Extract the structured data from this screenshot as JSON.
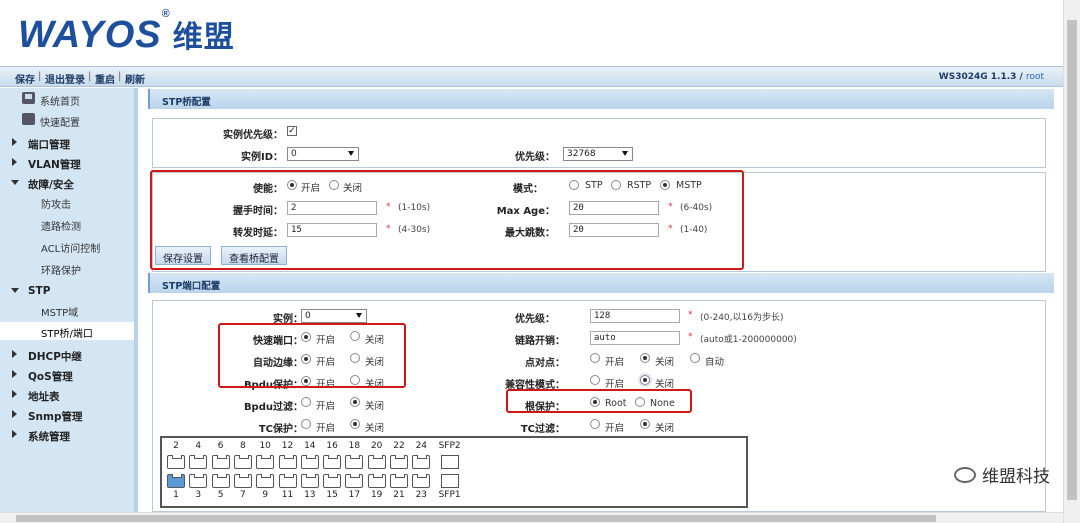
{
  "brand": {
    "name": "WAYOS",
    "reg": "®",
    "cn": "维盟"
  },
  "toolbar": {
    "save": "保存",
    "logout": "退出登录",
    "reboot": "重启",
    "refresh": "刷新",
    "sep": "|",
    "version": "WS3024G 1.1.3 /",
    "user": "root"
  },
  "sidebar": {
    "home": "系统首页",
    "quick": "快速配置",
    "port_mgmt": "端口管理",
    "vlan": "VLAN管理",
    "fault": "故障/安全",
    "anti_attack": "防攻击",
    "loop_detect": "遗路检测",
    "acl": "ACL访问控制",
    "ring": "环路保护",
    "stp": "STP",
    "mstp": "MSTP域",
    "stp_bridge": "STP桥/端口",
    "dhcp": "DHCP中继",
    "qos": "QoS管理",
    "addr": "地址表",
    "snmp": "Snmp管理",
    "sys": "系统管理"
  },
  "bridge": {
    "title": "STP桥配置",
    "instance_priority_label": "实例优先级：",
    "instance_priority_checked": true,
    "instance_id_label": "实例ID：",
    "instance_id_value": "0",
    "priority_label": "优先级：",
    "priority_value": "32768",
    "enable_label": "使能：",
    "enable_on": "开启",
    "enable_off": "关闭",
    "mode_label": "模式：",
    "mode_stp": "STP",
    "mode_rstp": "RSTP",
    "mode_mstp": "MSTP",
    "hello_label": "握手时间：",
    "hello_value": "2",
    "hello_range": "(1-10s)",
    "maxage_label": "Max Age：",
    "maxage_value": "20",
    "maxage_range": "(6-40s)",
    "fwd_label": "转发时延：",
    "fwd_value": "15",
    "fwd_range": "(4-30s)",
    "hops_label": "最大跳数：",
    "hops_value": "20",
    "hops_range": "(1-40)",
    "save_btn": "保存设置",
    "view_btn": "查看桥配置",
    "star": "*"
  },
  "port": {
    "title": "STP端口配置",
    "instance_label": "实例：",
    "instance_value": "0",
    "priority_label": "优先级：",
    "priority_value": "128",
    "priority_range": "(0-240,以16为步长)",
    "fast_label": "快速端口：",
    "cost_label": "链路开销：",
    "cost_value": "auto",
    "cost_range": "(auto或1-200000000)",
    "edge_label": "自动边缘：",
    "p2p_label": "点对点：",
    "bpdu_guard_label": "Bpdu保护：",
    "compat_label": "兼容性模式：",
    "bpdu_filter_label": "Bpdu过滤：",
    "root_guard_label": "根保护：",
    "root_opt": "Root",
    "none_opt": "None",
    "tc_guard_label": "TC保护：",
    "tc_filter_label": "TC过滤：",
    "on": "开启",
    "off": "关闭",
    "auto": "自动",
    "top_ports": [
      "2",
      "4",
      "6",
      "8",
      "10",
      "12",
      "14",
      "16",
      "18",
      "20",
      "22",
      "24",
      "SFP2"
    ],
    "bottom_ports": [
      "1",
      "3",
      "5",
      "7",
      "9",
      "11",
      "13",
      "15",
      "17",
      "19",
      "21",
      "23",
      "SFP1"
    ]
  },
  "watermark": "维盟科技"
}
